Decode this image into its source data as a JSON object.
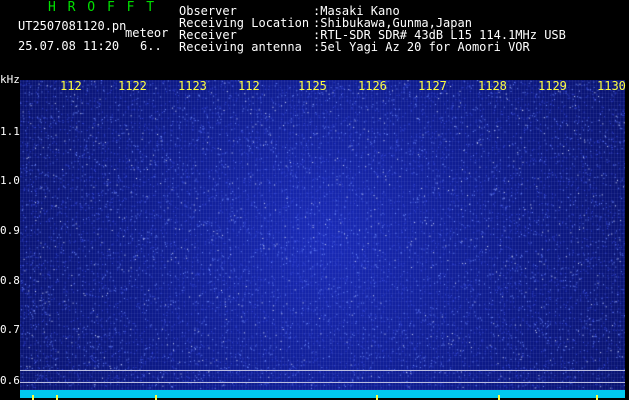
{
  "header": {
    "brand": "H R O F F T",
    "filename": "UT2507081120.pn",
    "meteor_tag": "meteor",
    "timestamp": "25.07.08 11:20",
    "count": "6..",
    "fields": [
      {
        "label": "Observer",
        "value": ":Masaki Kano"
      },
      {
        "label": "Receiving Location",
        "value": ":Shibukawa,Gunma,Japan"
      },
      {
        "label": "Receiver",
        "value": ":RTL-SDR SDR# 43dB L15 114.1MHz USB"
      },
      {
        "label": "Receiving antenna",
        "value": ":5el Yagi Az 20 for Aomori VOR"
      }
    ]
  },
  "axes": {
    "y_unit": "kHz",
    "y_ticks": [
      "1.1",
      "1.0",
      "0.9",
      "0.8",
      "0.7",
      "0.6"
    ],
    "x_ticks": [
      "112",
      "1122",
      "1123",
      "112",
      "1125",
      "1126",
      "1127",
      "1128",
      "1129",
      "1130"
    ]
  },
  "colors": {
    "background": "#0d1a88",
    "noise": "#6f8cff",
    "baseline": "#00c8f0",
    "ticks": "#ffff40",
    "brand": "#00e000"
  }
}
